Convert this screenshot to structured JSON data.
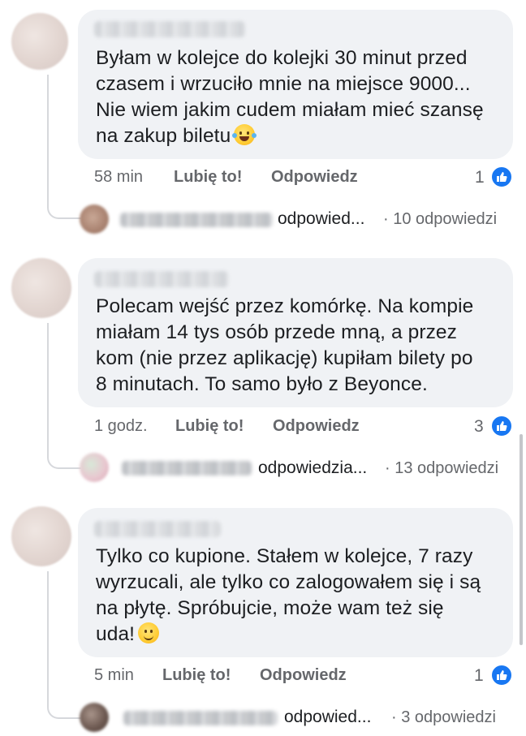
{
  "comments": [
    {
      "text": "Byłam w kolejce do kolejki 30 minut przed\nczasem i wrzuciło mnie na miejsce 9000...\nNie wiem jakim cudem miałam mieć szansę\nna zakup biletu",
      "emoji": "laughing-with-tears",
      "time": "58 min",
      "like_label": "Lubię to!",
      "reply_label": "Odpowiedz",
      "reaction_count": "1",
      "replies_preview": {
        "text": "odpowied...",
        "count": "· 10 odpowiedzi"
      }
    },
    {
      "text": "Polecam wejść przez komórkę. Na kompie\nmiałam 14 tys osób przede mną, a przez\nkom (nie przez aplikację) kupiłam bilety po\n8 minutach. To samo było z Beyonce.",
      "emoji": "",
      "time": "1 godz.",
      "like_label": "Lubię to!",
      "reply_label": "Odpowiedz",
      "reaction_count": "3",
      "replies_preview": {
        "text": "odpowiedzia...",
        "count": "· 13 odpowiedzi"
      }
    },
    {
      "text": "Tylko co kupione. Stałem w kolejce, 7 razy\nwyrzucali, ale tylko co zalogowałem się i są\nna płytę. Spróbujcie, może wam też się\nuda!",
      "emoji": "slightly-smiling",
      "time": "5 min",
      "like_label": "Lubię to!",
      "reply_label": "Odpowiedz",
      "reaction_count": "1",
      "replies_preview": {
        "text": "odpowied...",
        "count": "· 3 odpowiedzi"
      }
    }
  ],
  "colors": {
    "bubble": "#f0f2f5",
    "muted_text": "#65676b",
    "like_blue": "#1877f2"
  }
}
